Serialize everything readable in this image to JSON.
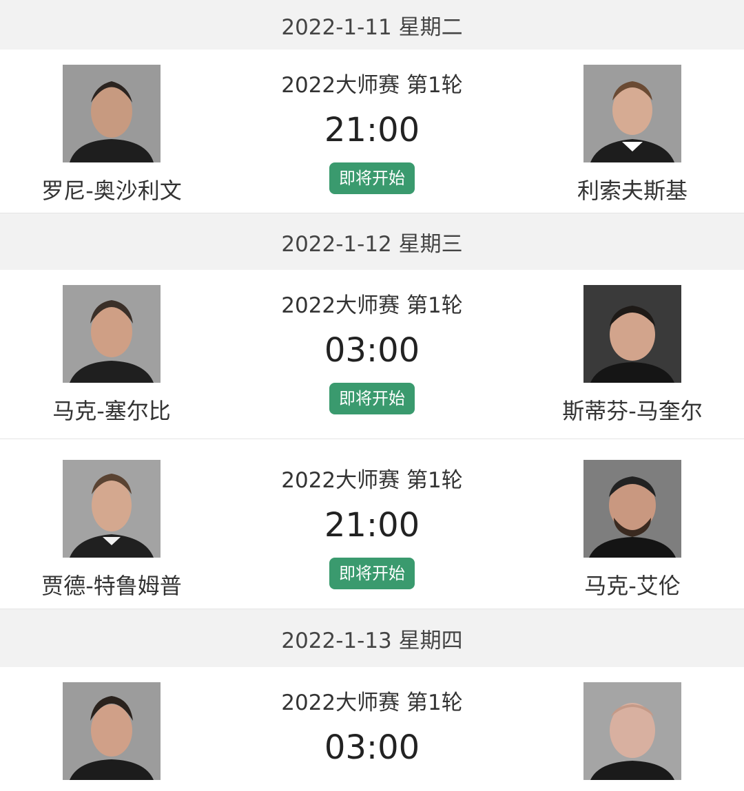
{
  "colors": {
    "badge_bg": "#3a9a6e",
    "header_bg": "#f2f2f2"
  },
  "days": [
    {
      "date": "2022-1-11 星期二",
      "matches": [
        {
          "event": "2022大师赛 第1轮",
          "time": "21:00",
          "status": "即将开始",
          "player1": "罗尼-奥沙利文",
          "player2": "利索夫斯基"
        }
      ]
    },
    {
      "date": "2022-1-12 星期三",
      "matches": [
        {
          "event": "2022大师赛 第1轮",
          "time": "03:00",
          "status": "即将开始",
          "player1": "马克-塞尔比",
          "player2": "斯蒂芬-马奎尔"
        },
        {
          "event": "2022大师赛 第1轮",
          "time": "21:00",
          "status": "即将开始",
          "player1": "贾德-特鲁姆普",
          "player2": "马克-艾伦"
        }
      ]
    },
    {
      "date": "2022-1-13 星期四",
      "matches": [
        {
          "event": "2022大师赛 第1轮",
          "time": "03:00",
          "player1": "",
          "player2": ""
        }
      ]
    }
  ]
}
